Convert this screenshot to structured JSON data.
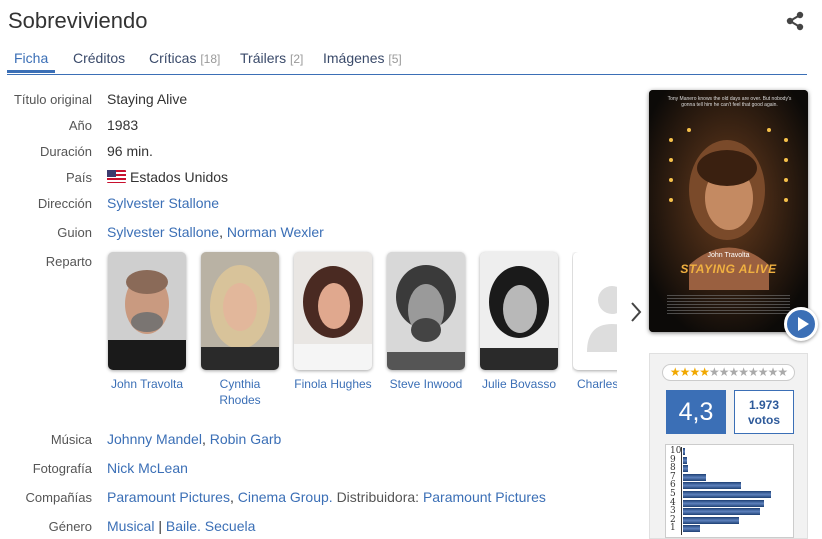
{
  "movie": {
    "title": "Sobreviviendo"
  },
  "tabs": [
    {
      "label": "Ficha",
      "count": ""
    },
    {
      "label": "Créditos",
      "count": ""
    },
    {
      "label": "Críticas",
      "count": "[18]"
    },
    {
      "label": "Tráilers",
      "count": "[2]"
    },
    {
      "label": "Imágenes",
      "count": "[5]"
    }
  ],
  "details": {
    "original_title": {
      "label": "Título original",
      "value": "Staying Alive"
    },
    "year": {
      "label": "Año",
      "value": "1983"
    },
    "duration": {
      "label": "Duración",
      "value": "96 min."
    },
    "country": {
      "label": "País",
      "value": "Estados Unidos"
    },
    "director": {
      "label": "Dirección",
      "value": "Sylvester Stallone"
    },
    "screenplay": {
      "label": "Guion",
      "names": [
        "Sylvester Stallone",
        "Norman Wexler"
      ]
    },
    "cast_label": "Reparto",
    "music": {
      "label": "Música",
      "names": [
        "Johnny Mandel",
        "Robin Garb"
      ]
    },
    "photography": {
      "label": "Fotografía",
      "value": "Nick McLean"
    },
    "companies": {
      "label": "Compañías",
      "names": [
        "Paramount Pictures",
        "Cinema Group."
      ],
      "distributor_label": "Distribuidora:",
      "distributor": "Paramount Pictures"
    },
    "genre": {
      "label": "Género",
      "names": [
        "Musical",
        "Baile. Secuela"
      ]
    }
  },
  "cast": [
    {
      "name": "John Travolta"
    },
    {
      "name": "Cynthia Rhodes"
    },
    {
      "name": "Finola Hughes"
    },
    {
      "name": "Steve Inwood"
    },
    {
      "name": "Julie Bovasso"
    },
    {
      "name": "Charles"
    }
  ],
  "poster": {
    "tagline": "Tony Manero knows the old days are over. But nobody's gonna tell him he can't feel that good again.",
    "actor": "John Travolta",
    "title": "STAYING ALIVE"
  },
  "rating": {
    "stars_on": 4,
    "stars_total": 12,
    "average": "4,3",
    "votes_count": "1.973",
    "votes_label": "votos",
    "histogram": [
      {
        "score": "10",
        "share": 0.02
      },
      {
        "score": "9",
        "share": 0.04
      },
      {
        "score": "8",
        "share": 0.05
      },
      {
        "score": "7",
        "share": 0.22
      },
      {
        "score": "6",
        "share": 0.55
      },
      {
        "score": "5",
        "share": 0.84
      },
      {
        "score": "4",
        "share": 0.77
      },
      {
        "score": "3",
        "share": 0.73
      },
      {
        "score": "2",
        "share": 0.53
      },
      {
        "score": "1",
        "share": 0.16
      }
    ]
  },
  "colors": {
    "accent": "#3b6fb6",
    "link": "#3b6fb6",
    "star": "#f1a800",
    "hist_bar": "#1d3f73"
  }
}
